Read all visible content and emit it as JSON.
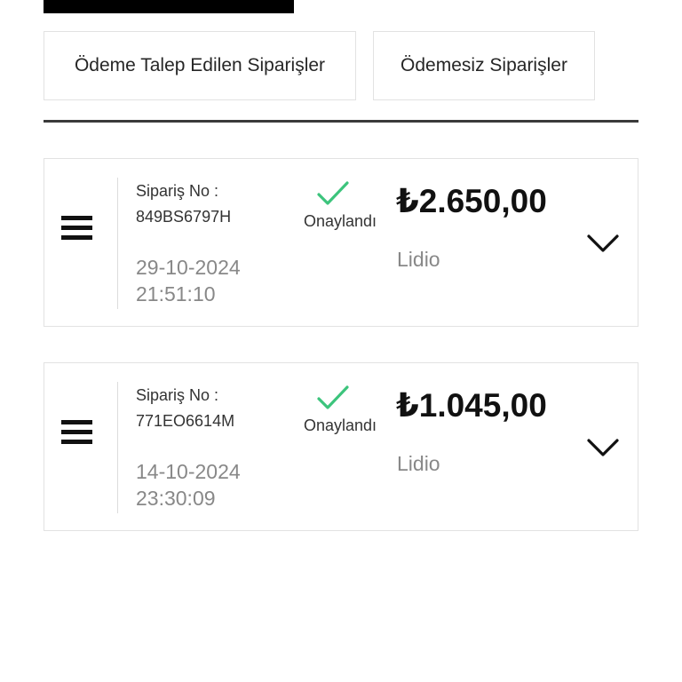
{
  "tabs": [
    {
      "label": "Ödeme Talep Edilen Siparişler"
    },
    {
      "label": "Ödemesiz Siparişler"
    }
  ],
  "orders": [
    {
      "order_label": "Sipariş No :",
      "order_no": "849BS6797H",
      "date": "29-10-2024",
      "time": "21:51:10",
      "status": "Onaylandı",
      "amount": "₺2.650,00",
      "merchant": "Lidio"
    },
    {
      "order_label": "Sipariş No :",
      "order_no": "771EO6614M",
      "date": "14-10-2024",
      "time": "23:30:09",
      "status": "Onaylandı",
      "amount": "₺1.045,00",
      "merchant": "Lidio"
    }
  ],
  "colors": {
    "check": "#3cc47c",
    "divider": "#3a3a3a",
    "muted_text": "#888888"
  },
  "icons": {
    "menu": "hamburger-menu-icon",
    "status": "check-icon",
    "expand": "chevron-down-icon"
  }
}
